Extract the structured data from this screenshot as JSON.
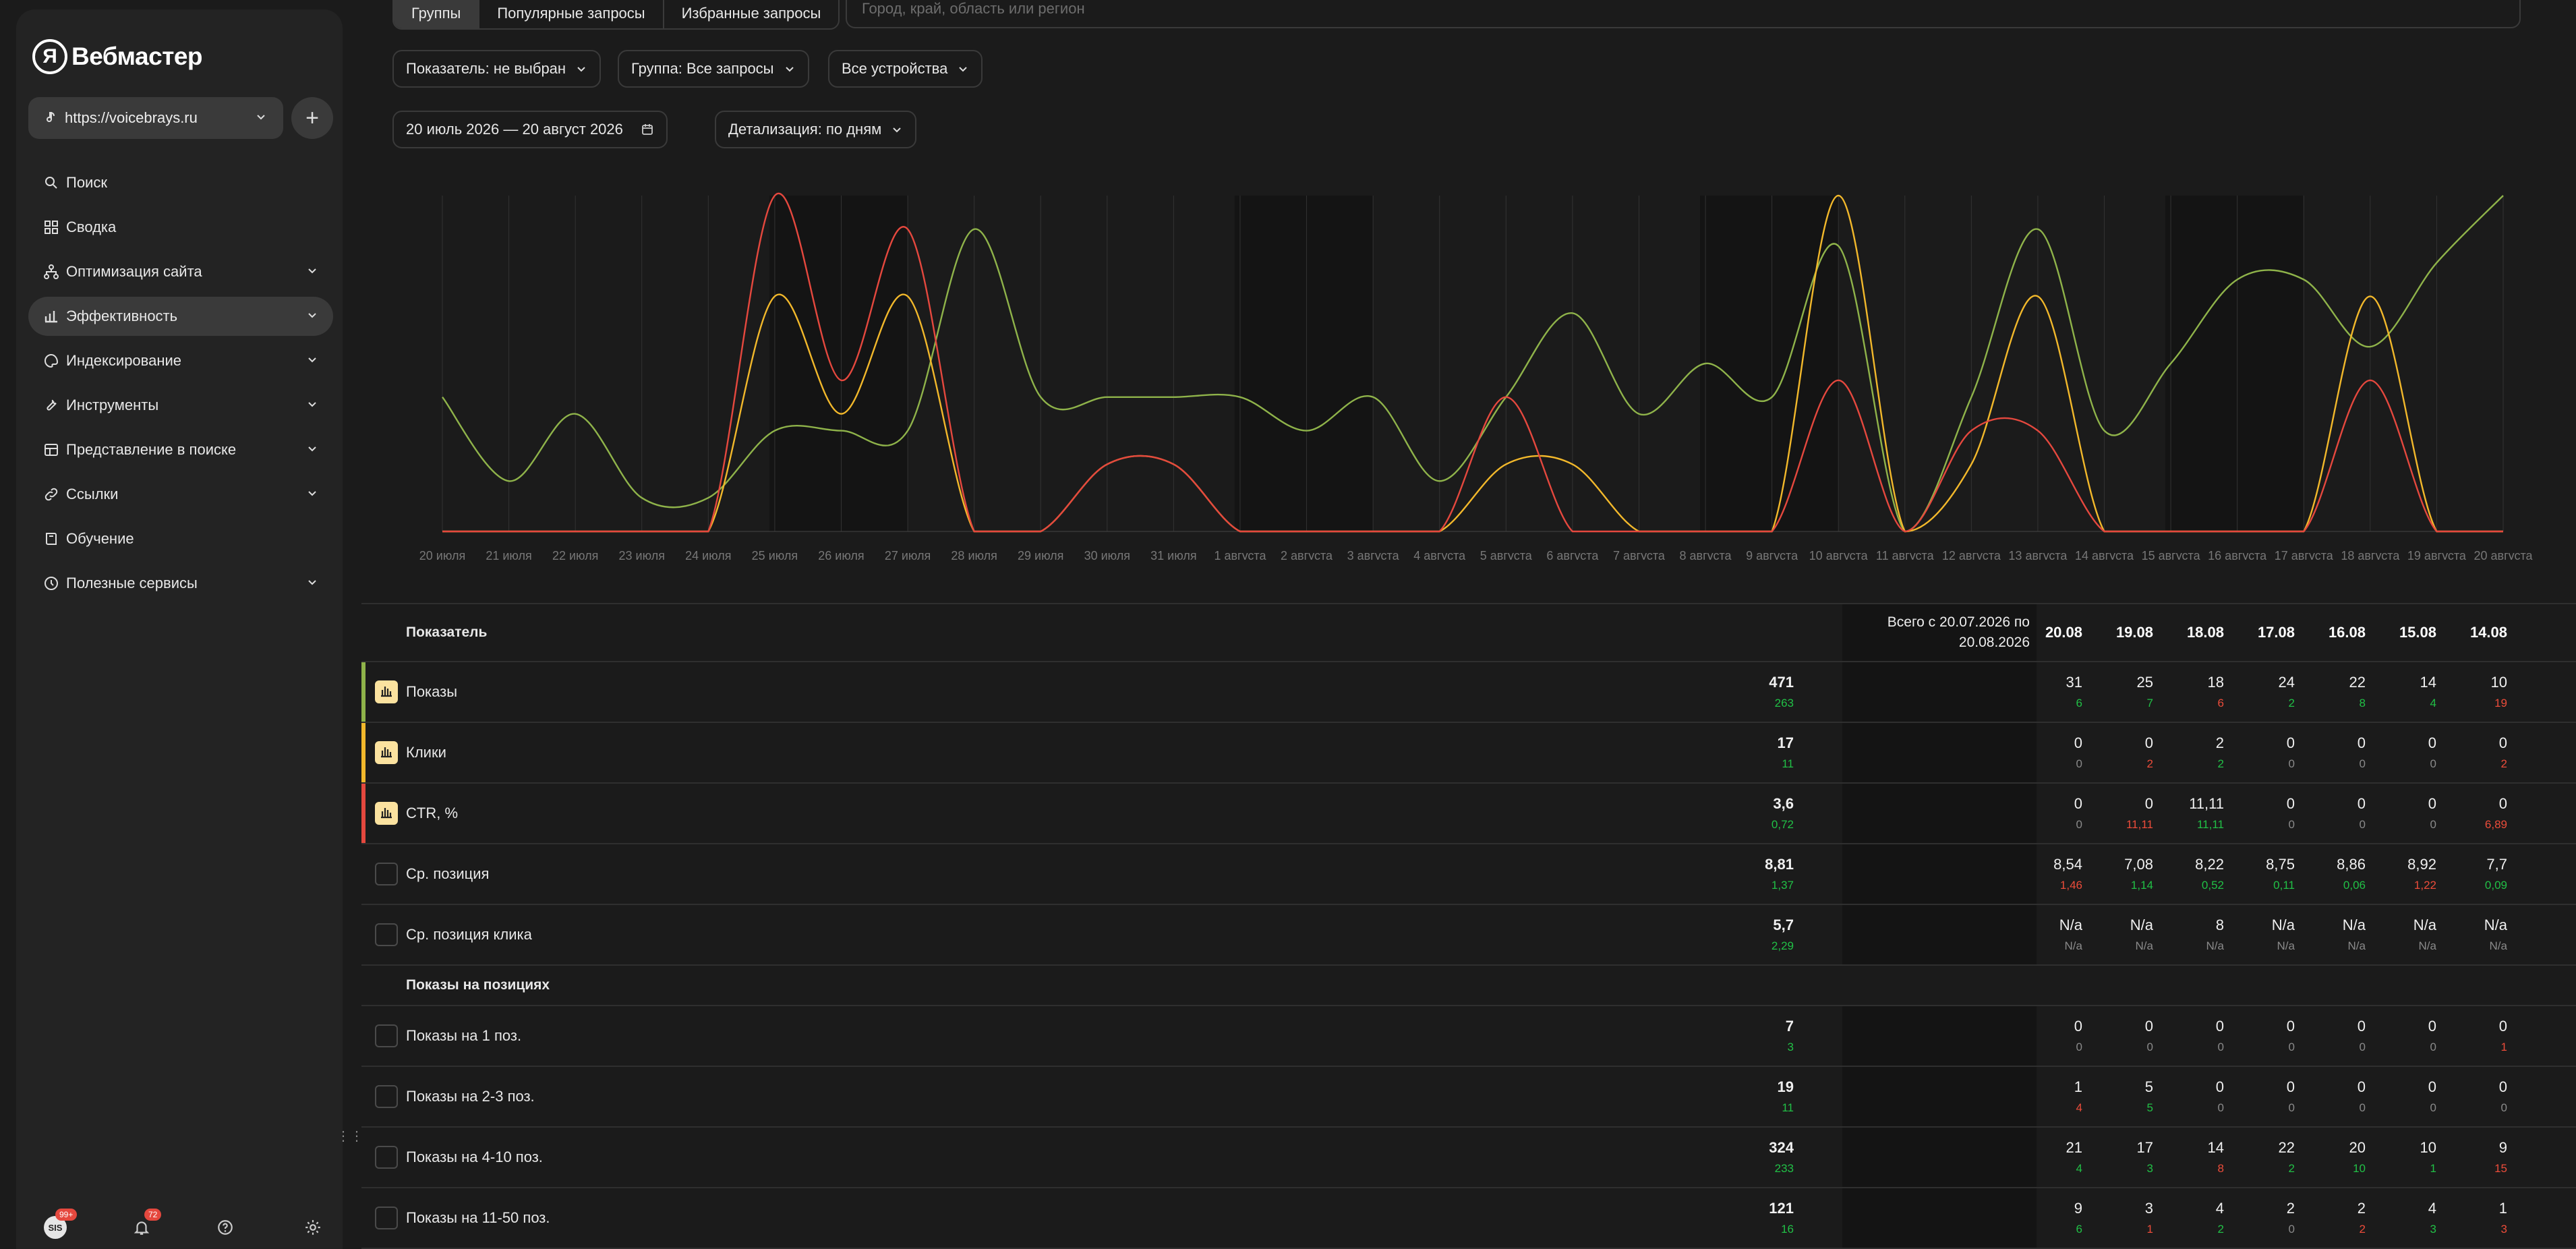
{
  "brand": {
    "logo_letter": "Я",
    "name": "Вебмастер"
  },
  "site": {
    "url": "https://voicebrays.ru"
  },
  "sidebar": {
    "items": [
      {
        "label": "Поиск",
        "icon": "search-icon",
        "chevron": false
      },
      {
        "label": "Сводка",
        "icon": "grid-icon",
        "chevron": false
      },
      {
        "label": "Оптимизация сайта",
        "icon": "hierarchy-icon",
        "chevron": true
      },
      {
        "label": "Эффективность",
        "icon": "bar-chart-icon",
        "chevron": true,
        "active": true
      },
      {
        "label": "Индексирование",
        "icon": "palette-icon",
        "chevron": true
      },
      {
        "label": "Инструменты",
        "icon": "tools-icon",
        "chevron": true
      },
      {
        "label": "Представление в поиске",
        "icon": "layout-icon",
        "chevron": true
      },
      {
        "label": "Ссылки",
        "icon": "link-icon",
        "chevron": true
      },
      {
        "label": "Обучение",
        "icon": "book-icon",
        "chevron": false
      },
      {
        "label": "Полезные сервисы",
        "icon": "services-icon",
        "chevron": true
      }
    ]
  },
  "footer": {
    "avatar": "SIS",
    "avatar_badge": "99+",
    "notify_badge": "72"
  },
  "tabs": [
    "Группы",
    "Популярные запросы",
    "Избранные запросы"
  ],
  "region": {
    "placeholder": "Город, край, область или регион"
  },
  "filters": {
    "indicator": "Показатель: не выбран",
    "group": "Группа: Все запросы",
    "devices": "Все устройства",
    "date": "20 июль 2026 — 20 август 2026",
    "detail": "Детализация: по дням"
  },
  "chart_data": {
    "type": "line",
    "x": [
      "20 июля",
      "21 июля",
      "22 июля",
      "23 июля",
      "24 июля",
      "25 июля",
      "26 июля",
      "27 июля",
      "28 июля",
      "29 июля",
      "30 июля",
      "31 июля",
      "1 августа",
      "2 августа",
      "3 августа",
      "4 августа",
      "5 августа",
      "6 августа",
      "7 августа",
      "8 августа",
      "9 августа",
      "10 августа",
      "11 августа",
      "12 августа",
      "13 августа",
      "14 августа",
      "15 августа",
      "16 августа",
      "17 августа",
      "18 августа",
      "19 августа",
      "20 августа"
    ],
    "weekends": [
      [
        5,
        7
      ],
      [
        12,
        14
      ],
      [
        19,
        21
      ],
      [
        26,
        28
      ]
    ],
    "series": [
      {
        "name": "Показы",
        "color": "#8fb34a",
        "values": [
          8,
          3,
          7,
          2,
          2,
          6,
          6,
          6,
          18,
          8,
          8,
          8,
          8,
          6,
          8,
          3,
          8,
          13,
          7,
          10,
          8,
          17,
          0,
          8,
          18,
          6,
          10,
          15,
          15,
          11,
          16,
          20
        ]
      },
      {
        "name": "Клики",
        "color": "#f2b82b",
        "values": [
          0,
          0,
          0,
          0,
          0,
          14,
          7,
          14,
          0,
          0,
          4,
          4,
          0,
          0,
          0,
          0,
          4,
          4,
          0,
          0,
          0,
          20,
          0,
          4,
          14,
          0,
          0,
          0,
          0,
          14,
          0,
          0
        ]
      },
      {
        "name": "CTR, %",
        "color": "#e5483e",
        "values": [
          0,
          0,
          0,
          0,
          0,
          20,
          9,
          18,
          0,
          0,
          4,
          4,
          0,
          0,
          0,
          0,
          8,
          0,
          0,
          0,
          0,
          9,
          0,
          6,
          6,
          0,
          0,
          0,
          0,
          9,
          0,
          0
        ]
      }
    ],
    "ylim": [
      0,
      20
    ]
  },
  "table": {
    "header": {
      "indicator": "Показатель",
      "total": "Всего с 20.07.2026 по 20.08.2026",
      "dates": [
        "20.08",
        "19.08",
        "18.08",
        "17.08",
        "16.08",
        "15.08",
        "14.08"
      ]
    },
    "rows": [
      {
        "type": "metric",
        "name": "Показы",
        "color": "#8fb34a",
        "checked": true,
        "total": "471",
        "total_delta": "263",
        "total_delta_color": "g",
        "values": [
          "31",
          "25",
          "18",
          "24",
          "22",
          "14",
          "10"
        ],
        "deltas": [
          "6",
          "7",
          "6",
          "2",
          "8",
          "4",
          "19"
        ],
        "delta_colors": [
          "g",
          "g",
          "r",
          "g",
          "g",
          "g",
          "r"
        ]
      },
      {
        "type": "metric",
        "name": "Клики",
        "color": "#f2b82b",
        "checked": true,
        "total": "17",
        "total_delta": "11",
        "total_delta_color": "g",
        "values": [
          "0",
          "0",
          "2",
          "0",
          "0",
          "0",
          "0"
        ],
        "deltas": [
          "0",
          "2",
          "2",
          "0",
          "0",
          "0",
          "2"
        ],
        "delta_colors": [
          "n",
          "r",
          "g",
          "n",
          "n",
          "n",
          "r"
        ]
      },
      {
        "type": "metric",
        "name": "CTR, %",
        "color": "#e5483e",
        "checked": true,
        "total": "3,6",
        "total_delta": "0,72",
        "total_delta_color": "g",
        "values": [
          "0",
          "0",
          "11,11",
          "0",
          "0",
          "0",
          "0"
        ],
        "deltas": [
          "0",
          "11,11",
          "11,11",
          "0",
          "0",
          "0",
          "6,89"
        ],
        "delta_colors": [
          "n",
          "r",
          "g",
          "n",
          "n",
          "n",
          "r"
        ]
      },
      {
        "type": "metric",
        "name": "Ср. позиция",
        "checked": false,
        "total": "8,81",
        "total_delta": "1,37",
        "total_delta_color": "g",
        "values": [
          "8,54",
          "7,08",
          "8,22",
          "8,75",
          "8,86",
          "8,92",
          "7,7"
        ],
        "deltas": [
          "1,46",
          "1,14",
          "0,52",
          "0,11",
          "0,06",
          "1,22",
          "0,09"
        ],
        "delta_colors": [
          "r",
          "g",
          "g",
          "g",
          "g",
          "r",
          "g"
        ]
      },
      {
        "type": "metric",
        "name": "Ср. позиция клика",
        "checked": false,
        "total": "5,7",
        "total_delta": "2,29",
        "total_delta_color": "g",
        "values": [
          "N/a",
          "N/a",
          "8",
          "N/a",
          "N/a",
          "N/a",
          "N/a"
        ],
        "deltas": [
          "N/a",
          "N/a",
          "N/a",
          "N/a",
          "N/a",
          "N/a",
          "N/a"
        ],
        "delta_colors": [
          "n",
          "n",
          "n",
          "n",
          "n",
          "n",
          "n"
        ]
      },
      {
        "type": "section",
        "name": "Показы на позициях"
      },
      {
        "type": "metric",
        "name": "Показы на 1 поз.",
        "checked": false,
        "total": "7",
        "total_delta": "3",
        "total_delta_color": "g",
        "values": [
          "0",
          "0",
          "0",
          "0",
          "0",
          "0",
          "0"
        ],
        "deltas": [
          "0",
          "0",
          "0",
          "0",
          "0",
          "0",
          "1"
        ],
        "delta_colors": [
          "n",
          "n",
          "n",
          "n",
          "n",
          "n",
          "r"
        ]
      },
      {
        "type": "metric",
        "name": "Показы на 2-3 поз.",
        "checked": false,
        "total": "19",
        "total_delta": "11",
        "total_delta_color": "g",
        "values": [
          "1",
          "5",
          "0",
          "0",
          "0",
          "0",
          "0"
        ],
        "deltas": [
          "4",
          "5",
          "0",
          "0",
          "0",
          "0",
          "0"
        ],
        "delta_colors": [
          "r",
          "g",
          "n",
          "n",
          "n",
          "n",
          "n"
        ]
      },
      {
        "type": "metric",
        "name": "Показы на 4-10 поз.",
        "checked": false,
        "total": "324",
        "total_delta": "233",
        "total_delta_color": "g",
        "values": [
          "21",
          "17",
          "14",
          "22",
          "20",
          "10",
          "9"
        ],
        "deltas": [
          "4",
          "3",
          "8",
          "2",
          "10",
          "1",
          "15"
        ],
        "delta_colors": [
          "g",
          "g",
          "r",
          "g",
          "g",
          "g",
          "r"
        ]
      },
      {
        "type": "metric",
        "name": "Показы на 11-50 поз.",
        "checked": false,
        "total": "121",
        "total_delta": "16",
        "total_delta_color": "g",
        "values": [
          "9",
          "3",
          "4",
          "2",
          "2",
          "4",
          "1"
        ],
        "deltas": [
          "6",
          "1",
          "2",
          "0",
          "2",
          "3",
          "3"
        ],
        "delta_colors": [
          "g",
          "r",
          "g",
          "n",
          "r",
          "g",
          "r"
        ]
      }
    ]
  }
}
